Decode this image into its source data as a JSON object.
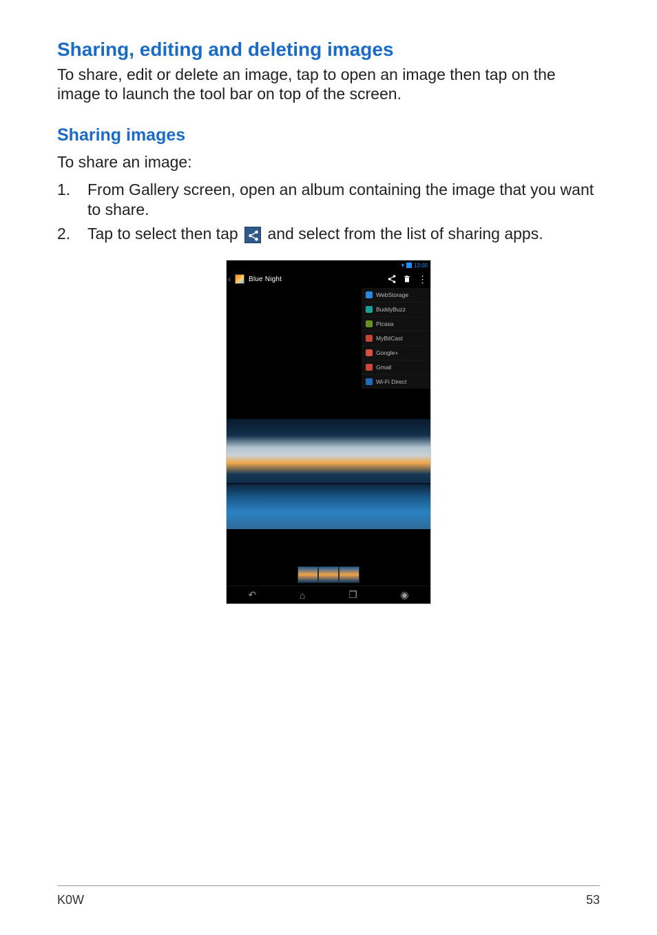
{
  "heading_main": "Sharing, editing and deleting images",
  "intro": "To share, edit or delete an image, tap to open an image then tap on the image to launch the tool bar on top of the screen.",
  "heading_sub": "Sharing images",
  "lead": "To share an image:",
  "steps": {
    "s1": "From Gallery screen, open an album containing the image that you want to share.",
    "s2a": "Tap to select then tap ",
    "s2b": " and select from the list of sharing apps."
  },
  "phone": {
    "statusbar": {
      "time": "13:00"
    },
    "album_name": "Blue Night",
    "share_menu": [
      "WebStorage",
      "BuddyBuzz",
      "Picasa",
      "MyBitCast",
      "Google+",
      "Gmail",
      "Wi-Fi Direct"
    ]
  },
  "footer": {
    "model": "K0W",
    "page": "53"
  }
}
